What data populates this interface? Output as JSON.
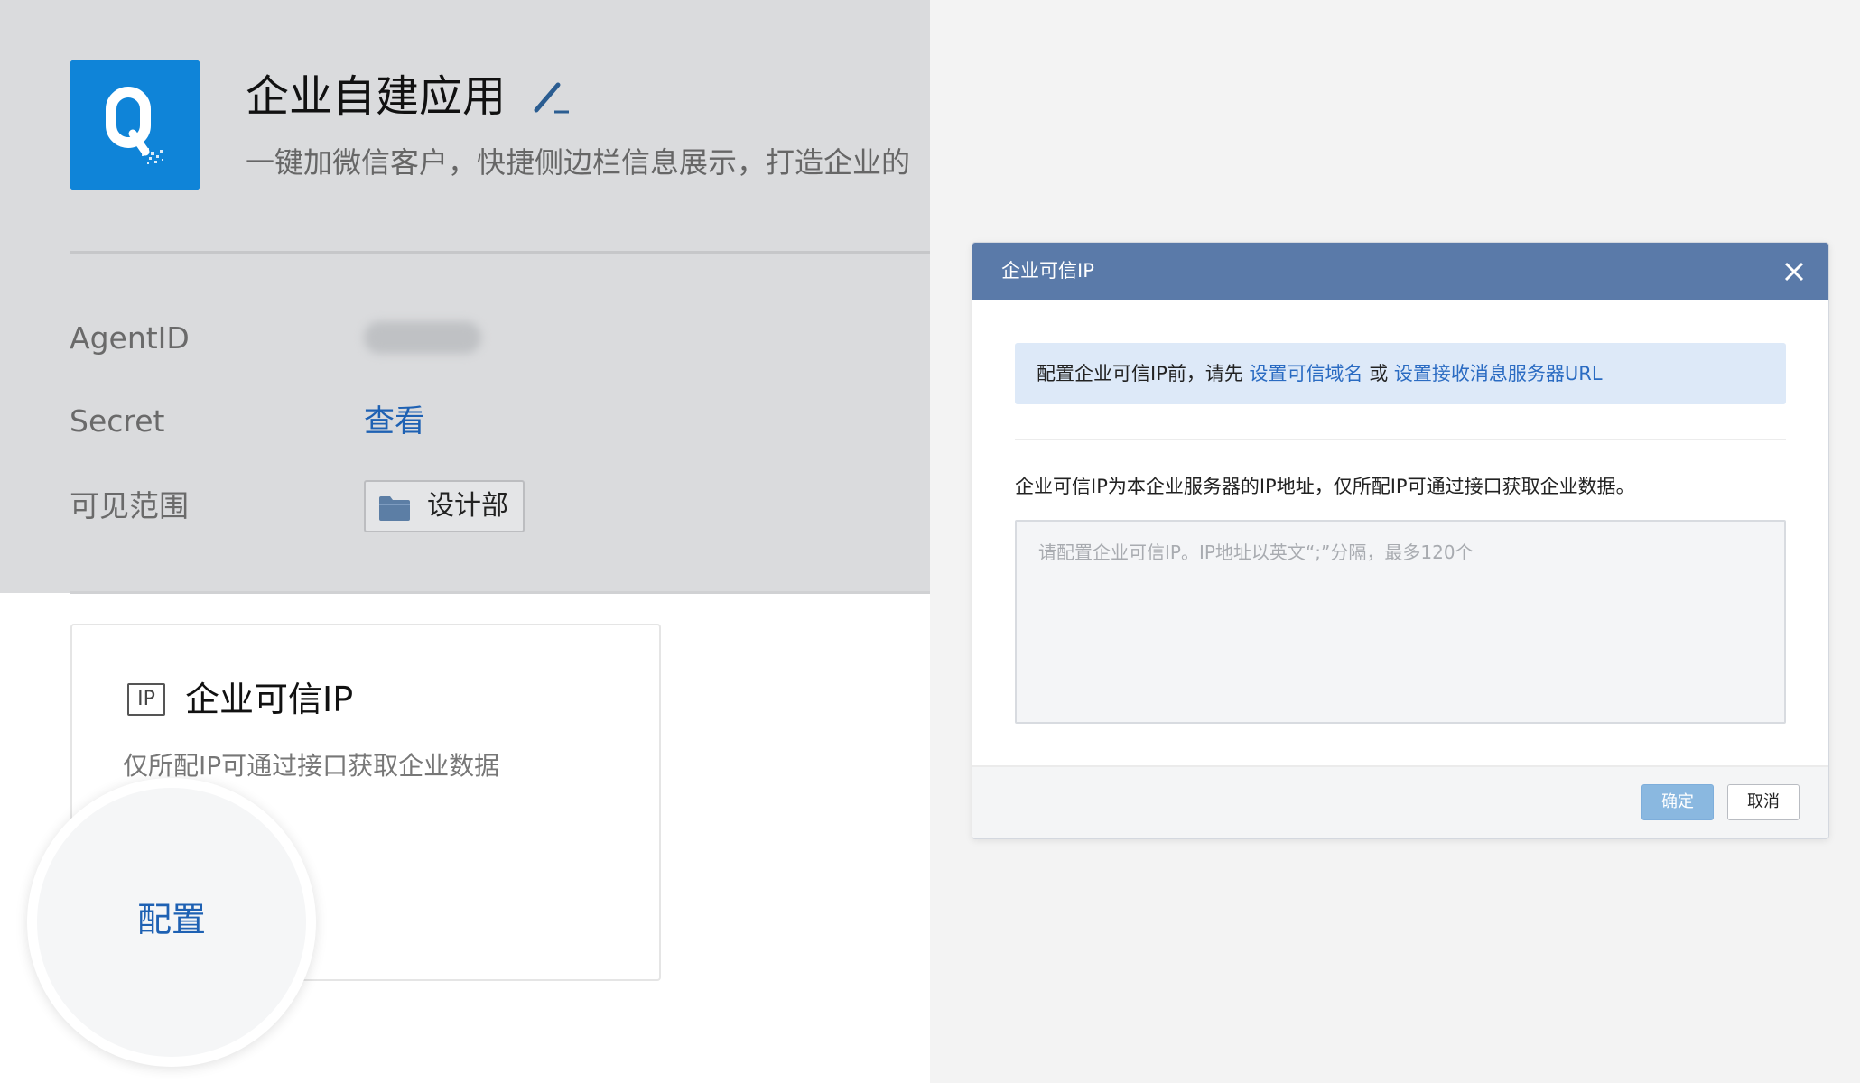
{
  "app": {
    "title": "企业自建应用",
    "description": "一键加微信客户，快捷侧边栏信息展示，打造企业的",
    "logo_color": "#0f84d8",
    "icons": [
      "edit-icon",
      "folder-icon",
      "close-icon"
    ]
  },
  "info": {
    "agentid_label": "AgentID",
    "secret_label": "Secret",
    "secret_link": "查看",
    "scope_label": "可见范围",
    "scope_value": "设计部"
  },
  "card": {
    "badge": "IP",
    "title": "企业可信IP",
    "description": "仅所配IP可通过接口获取企业数据",
    "action": "配置"
  },
  "modal": {
    "title": "企业可信IP",
    "notice_prefix": "配置企业可信IP前，请先",
    "notice_link1": "设置可信域名",
    "notice_or": "或",
    "notice_link2": "设置接收消息服务器URL",
    "description": "企业可信IP为本企业服务器的IP地址，仅所配IP可通过接口获取企业数据。",
    "placeholder": "请配置企业可信IP。IP地址以英文“;”分隔，最多120个",
    "value": "",
    "confirm": "确定",
    "cancel": "取消",
    "header_color": "#5a7aa9",
    "link_color": "#2a6bc2"
  }
}
